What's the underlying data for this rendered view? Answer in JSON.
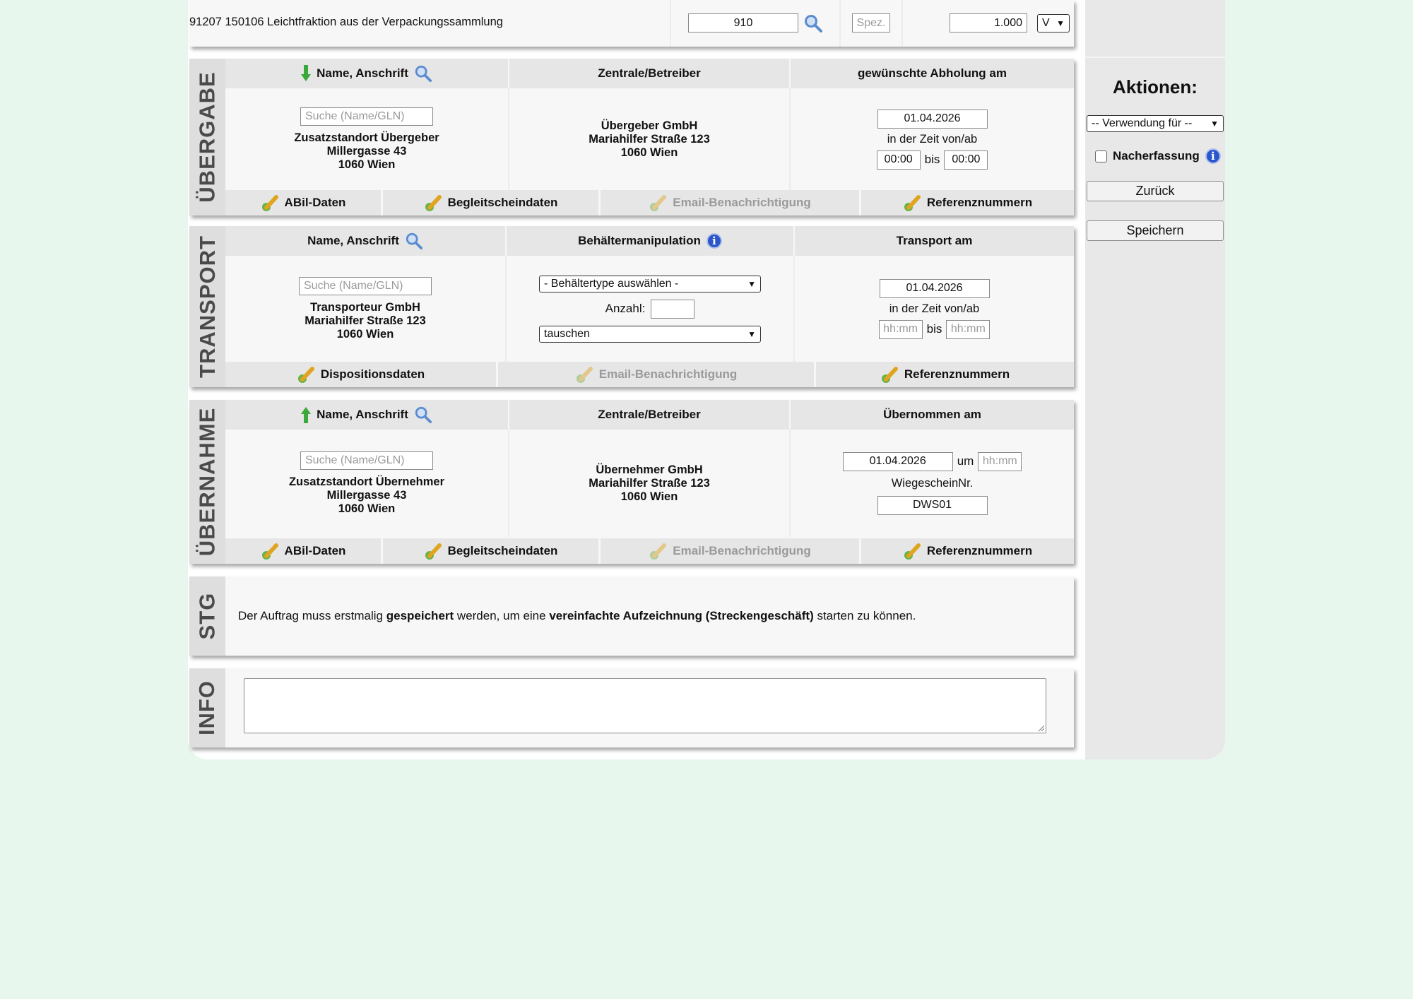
{
  "top_row": {
    "label": "91207 150106 Leichtfraktion aus der Verpackungssammlung",
    "code_value": "910",
    "spez_placeholder": "Spez.",
    "amount_value": "1.000",
    "unit_select": "V"
  },
  "uebergabe": {
    "side_label": "ÜBERGABE",
    "col1_header": "Name, Anschrift",
    "col2_header": "Zentrale/Betreiber",
    "col3_header": "gewünschte Abholung am",
    "search_placeholder": "Suche (Name/GLN)",
    "addr1": [
      "Zusatzstandort Übergeber",
      "Millergasse 43",
      "1060 Wien"
    ],
    "addr2": [
      "Übergeber GmbH",
      "Mariahilfer Straße 123",
      "1060 Wien"
    ],
    "date": "01.04.2026",
    "time_label": "in der Zeit von/ab",
    "time_from": "00:00",
    "bis": "bis",
    "time_to": "00:00",
    "footer": [
      "ABil-Daten",
      "Begleitscheindaten",
      "Email-Benachrichtigung",
      "Referenznummern"
    ]
  },
  "transport": {
    "side_label": "TRANSPORT",
    "col1_header": "Name, Anschrift",
    "col2_header": "Behältermanipulation",
    "col3_header": "Transport am",
    "search_placeholder": "Suche (Name/GLN)",
    "addr1": [
      "Transporteur GmbH",
      "Mariahilfer Straße 123",
      "1060 Wien"
    ],
    "container_select": "- Behältertype auswählen -",
    "anzahl_label": "Anzahl:",
    "action_select": "tauschen",
    "date": "01.04.2026",
    "time_label": "in der Zeit von/ab",
    "time_from_placeholder": "hh:mm",
    "bis": "bis",
    "time_to_placeholder": "hh:mm",
    "footer": [
      "Dispositionsdaten",
      "Email-Benachrichtigung",
      "Referenznummern"
    ]
  },
  "uebernahme": {
    "side_label": "ÜBERNAHME",
    "col1_header": "Name, Anschrift",
    "col2_header": "Zentrale/Betreiber",
    "col3_header": "Übernommen am",
    "search_placeholder": "Suche (Name/GLN)",
    "addr1": [
      "Zusatzstandort Übernehmer",
      "Millergasse 43",
      "1060 Wien"
    ],
    "addr2": [
      "Übernehmer GmbH",
      "Mariahilfer Straße 123",
      "1060 Wien"
    ],
    "date": "01.04.2026",
    "um": "um",
    "time_placeholder": "hh:mm",
    "wiege_label": "WiegescheinNr.",
    "wiege_value": "DWS01",
    "footer": [
      "ABil-Daten",
      "Begleitscheindaten",
      "Email-Benachrichtigung",
      "Referenznummern"
    ]
  },
  "stg": {
    "side_label": "STG",
    "text_1": "Der Auftrag muss erstmalig ",
    "text_2": "gespeichert",
    "text_3": " werden, um eine ",
    "text_4": "vereinfachte Aufzeichnung (Streckengeschäft)",
    "text_5": " starten zu können."
  },
  "info": {
    "side_label": "INFO"
  },
  "aktionen": {
    "title": "Aktionen:",
    "verwendung_select": "-- Verwendung für --",
    "nacherfassung_label": "Nacherfassung",
    "back_button": "Zurück",
    "save_button": "Speichern"
  }
}
